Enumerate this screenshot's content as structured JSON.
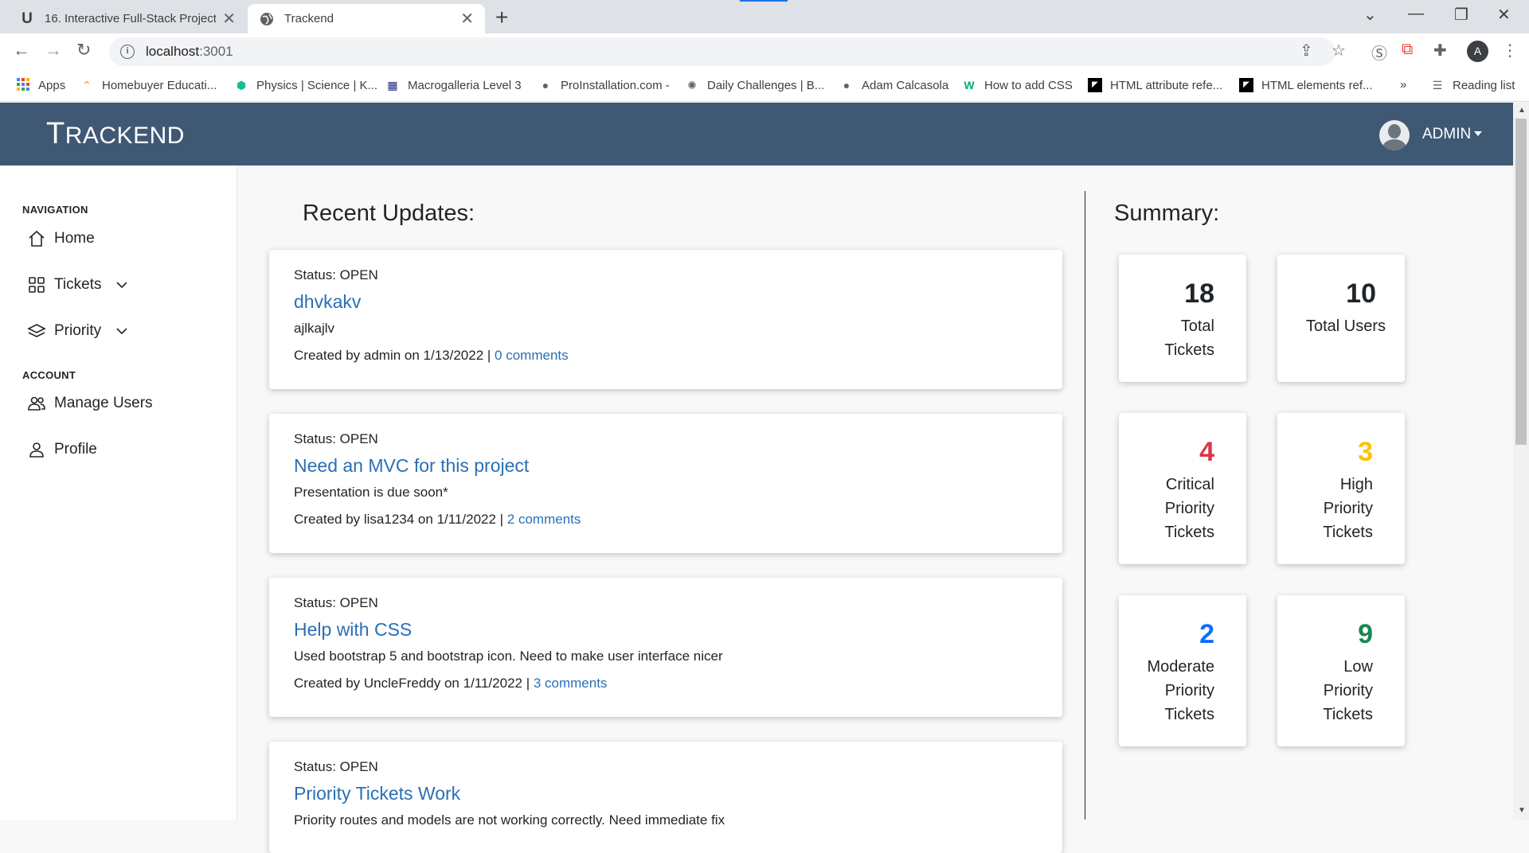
{
  "browser": {
    "tabs": [
      {
        "title": "16. Interactive Full-Stack Project",
        "favicon": "U"
      },
      {
        "title": "Trackend",
        "favicon": "globe-icon"
      }
    ],
    "url_host": "localhost",
    "url_port": ":3001",
    "profile_initial": "A",
    "bookmarks": [
      {
        "label": "Apps"
      },
      {
        "label": "Homebuyer Educati..."
      },
      {
        "label": "Physics | Science | K..."
      },
      {
        "label": "Macrogalleria Level 3"
      },
      {
        "label": "ProInstallation.com -"
      },
      {
        "label": "Daily Challenges | B..."
      },
      {
        "label": "Adam Calcasola"
      },
      {
        "label": "How to add CSS"
      },
      {
        "label": "HTML attribute refe..."
      },
      {
        "label": "HTML elements ref..."
      }
    ],
    "overflow": "»",
    "reading_list": "Reading list"
  },
  "header": {
    "brand_first": "T",
    "brand_rest": "RACKEND",
    "user": "ADMIN"
  },
  "sidebar": {
    "nav_heading": "NAVIGATION",
    "account_heading": "ACCOUNT",
    "items": [
      {
        "label": "Home"
      },
      {
        "label": "Tickets"
      },
      {
        "label": "Priority"
      },
      {
        "label": "Manage Users"
      },
      {
        "label": "Profile"
      }
    ]
  },
  "updates": {
    "title": "Recent Updates:",
    "items": [
      {
        "status": "Status: OPEN",
        "title": "dhvkakv",
        "desc": "ajlkajlv",
        "meta": "Created by admin on 1/13/2022 | ",
        "comments": "0 comments"
      },
      {
        "status": "Status: OPEN",
        "title": "Need an MVC for this project",
        "desc": "Presentation is due soon*",
        "meta": "Created by lisa1234 on 1/11/2022 | ",
        "comments": "2 comments"
      },
      {
        "status": "Status: OPEN",
        "title": "Help with CSS",
        "desc": "Used bootstrap 5 and bootstrap icon. Need to make user interface nicer",
        "meta": "Created by UncleFreddy on 1/11/2022 | ",
        "comments": "3 comments"
      },
      {
        "status": "Status: OPEN",
        "title": "Priority Tickets Work",
        "desc": "Priority routes and models are not working correctly. Need immediate fix",
        "meta": "",
        "comments": ""
      }
    ]
  },
  "summary": {
    "title": "Summary:",
    "stats": [
      {
        "value": "18",
        "label_lines": [
          "Total",
          "Tickets"
        ],
        "color": "#212529"
      },
      {
        "value": "10",
        "label_lines": [
          "Total Users"
        ],
        "color": "#212529"
      },
      {
        "value": "4",
        "label_lines": [
          "Critical",
          "Priority",
          "Tickets"
        ],
        "color": "#dc3545"
      },
      {
        "value": "3",
        "label_lines": [
          "High",
          "Priority",
          "Tickets"
        ],
        "color": "#ffc107"
      },
      {
        "value": "2",
        "label_lines": [
          "Moderate",
          "Priority",
          "Tickets"
        ],
        "color": "#0d6efd"
      },
      {
        "value": "9",
        "label_lines": [
          "Low",
          "Priority",
          "Tickets"
        ],
        "color": "#198754"
      }
    ]
  }
}
